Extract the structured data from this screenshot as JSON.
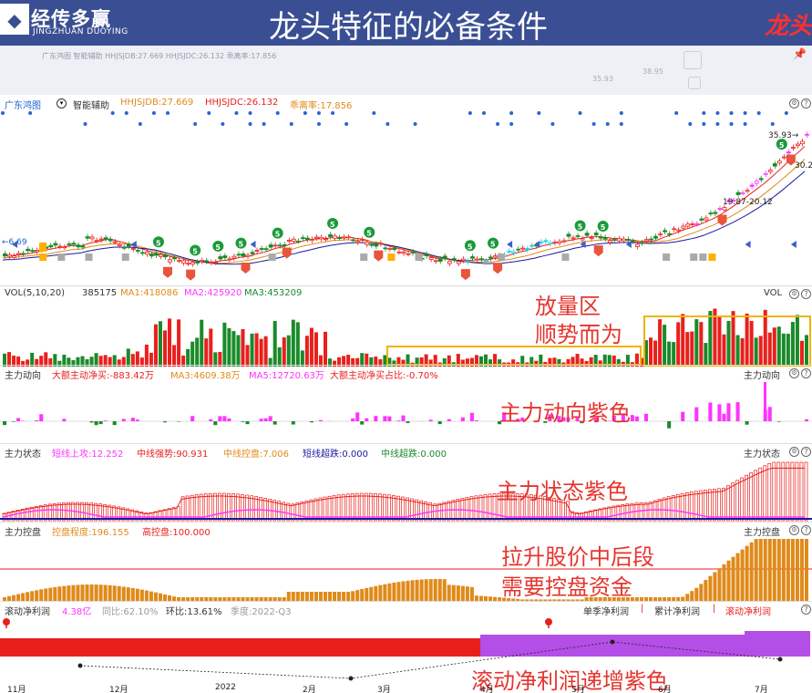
{
  "header": {
    "brand_cn": "经传多赢",
    "brand_en": "JINGZHUAN DUOYING",
    "title": "龙头特征的必备条件",
    "corner": "龙头"
  },
  "toolbar": {
    "blurred_row": "广东鸿图   智能辅助  HHJSJDB:27.669  HHJSJDC:26.132  乖离率:17.856",
    "nums": [
      "38.95",
      "35.93"
    ]
  },
  "kline": {
    "stock": "广东鸿图",
    "assist": "智能辅助",
    "ind1": "HHJSJDB:27.669",
    "ind2": "HHJSJDC:26.132",
    "ind3": "乖离率:17.856",
    "price_high": "35.93→",
    "price_right": "30.2",
    "range_label": "19.87-20.12",
    "price_low": "←6.69"
  },
  "vol": {
    "name": "VOL(5,10,20)",
    "value": "385175",
    "ma1": "MA1:418086",
    "ma2": "MA2:425920",
    "ma3": "MA3:453209",
    "right": "VOL"
  },
  "zldx": {
    "name": "主力动向",
    "a": "大额主动净买:-883.42万",
    "b": "MA3:4609.38万",
    "c": "MA5:12720.63万",
    "d": "大额主动净买占比:-0.70%",
    "right": "主力动向"
  },
  "zlzt": {
    "name": "主力状态",
    "a": "短线上攻:12.252",
    "b": "中线强势:90.931",
    "c": "中线控盘:7.006",
    "d": "短线超跌:0.000",
    "e": "中线超跌:0.000",
    "right": "主力状态"
  },
  "zlkp": {
    "name": "主力控盘",
    "a": "控盘程度:196.155",
    "b": "高控盘:100.000",
    "right": "主力控盘"
  },
  "profit": {
    "name": "滚动净利润",
    "value": "4.38亿",
    "yoy": "同比:62.10%",
    "qoq": "环比:13.61%",
    "season": "季度:2022-Q3",
    "tab1": "单季净利润",
    "tab2": "累计净利润",
    "tab3": "滚动净利润"
  },
  "annotations": {
    "a1": "放量区",
    "a2": "顺势而为",
    "a3": "主力动向紫色",
    "a4": "主力状态紫色",
    "a5": "拉升股价中后段",
    "a6": "需要控盘资金",
    "a7": "滚动净利润递增紫色"
  },
  "xaxis": [
    "11月",
    "12月",
    "2022",
    "2月",
    "3月",
    "4月",
    "5月",
    "6月",
    "7月"
  ],
  "colors": {
    "up": "#e8201c",
    "down": "#1a8a2a",
    "purple": "#ff33ff",
    "accent": "#e4352e",
    "header": "#3a4f93",
    "ctrl": "#e08a1a"
  }
}
